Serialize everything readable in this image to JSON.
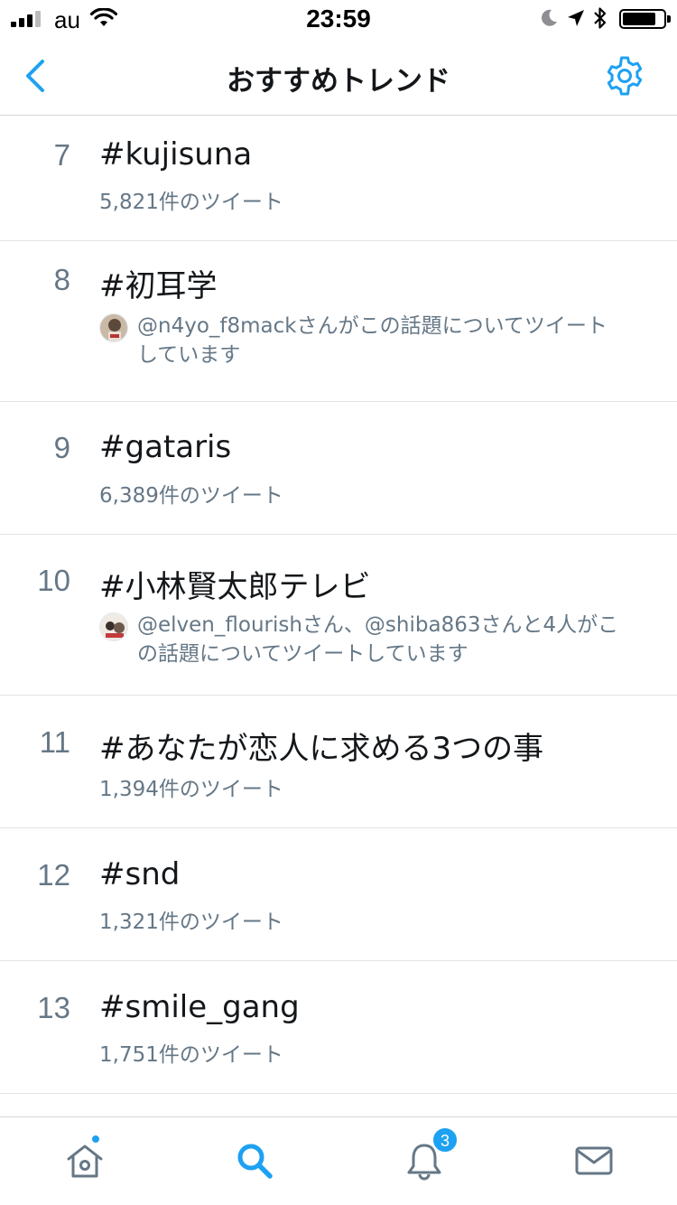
{
  "status_bar": {
    "carrier": "au",
    "time": "23:59"
  },
  "nav": {
    "title": "おすすめトレンド",
    "back_icon": "chevron-left-icon",
    "settings_icon": "gear-icon",
    "accent": "#1da1f2"
  },
  "trends": [
    {
      "rank": "7",
      "name": "#kujisuna",
      "tweets": "5,821件のツイート"
    },
    {
      "rank": "8",
      "name": "#初耳学",
      "context": "@n4yo_f8mackさんがこの話題についてツイートしています",
      "context_lines": [
        "@n4yo_f8mackさんがこの話題についてツイート",
        "しています"
      ]
    },
    {
      "rank": "9",
      "name": "#gataris",
      "tweets": "6,389件のツイート"
    },
    {
      "rank": "10",
      "name": "#小林賢太郎テレビ",
      "context": "@elven_flourishさん、@shiba863さんと4人がこの話題についてツイートしています",
      "context_lines": [
        "@elven_flourishさん、@shiba863さんと4人がこ",
        "の話題についてツイートしています"
      ]
    },
    {
      "rank": "11",
      "name": "#あなたが恋人に求める3つの事",
      "tweets": "1,394件のツイート"
    },
    {
      "rank": "12",
      "name": "#snd",
      "tweets": "1,321件のツイート"
    },
    {
      "rank": "13",
      "name": "#smile_gang",
      "tweets": "1,751件のツイート"
    }
  ],
  "tabbar": {
    "tabs": [
      {
        "name": "home",
        "icon": "home-icon",
        "has_dot": true
      },
      {
        "name": "search",
        "icon": "search-icon",
        "active": true
      },
      {
        "name": "notifications",
        "icon": "bell-icon",
        "badge": "3"
      },
      {
        "name": "messages",
        "icon": "mail-icon"
      }
    ]
  }
}
